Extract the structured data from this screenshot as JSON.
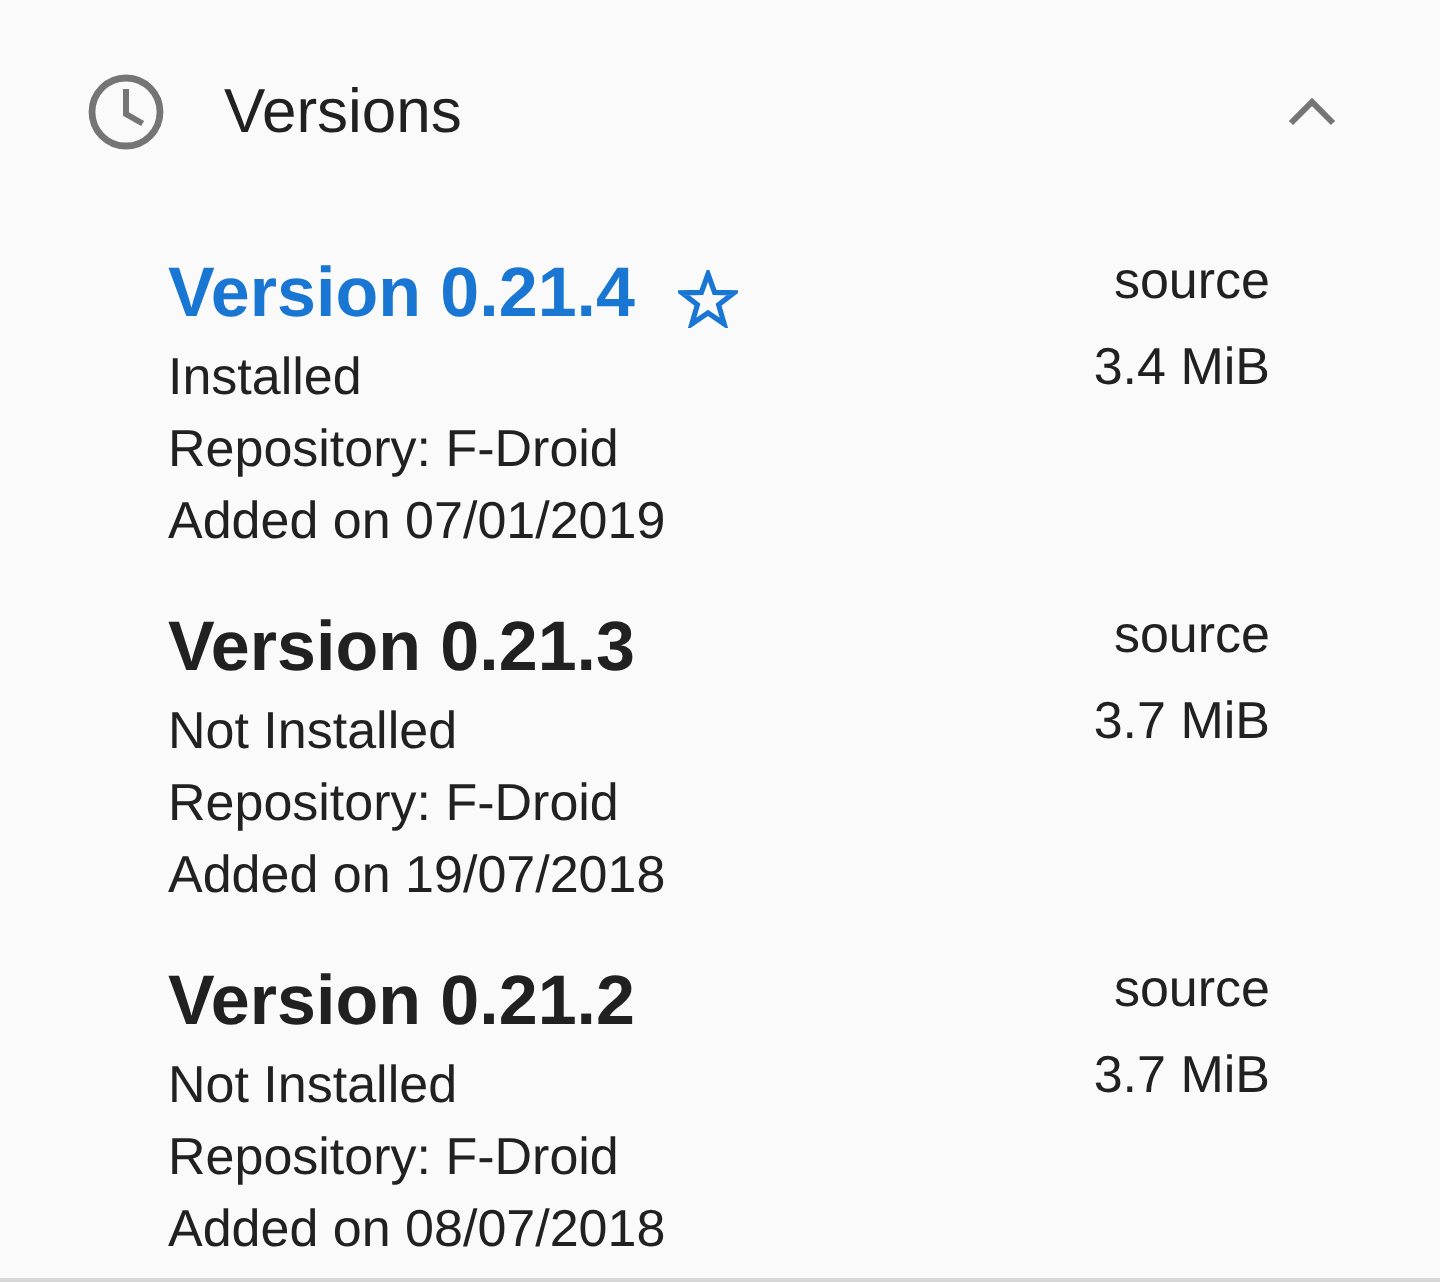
{
  "section": {
    "title": "Versions",
    "expanded": true
  },
  "versions": [
    {
      "title": "Version 0.21.4",
      "installed": true,
      "suggested": true,
      "status": "Installed",
      "repository": "Repository: F-Droid",
      "added": "Added on 07/01/2019",
      "source": "source",
      "size": "3.4 MiB"
    },
    {
      "title": "Version 0.21.3",
      "installed": false,
      "suggested": false,
      "status": "Not Installed",
      "repository": "Repository: F-Droid",
      "added": "Added on 19/07/2018",
      "source": "source",
      "size": "3.7 MiB"
    },
    {
      "title": "Version 0.21.2",
      "installed": false,
      "suggested": false,
      "status": "Not Installed",
      "repository": "Repository: F-Droid",
      "added": "Added on 08/07/2018",
      "source": "source",
      "size": "3.7 MiB"
    }
  ]
}
